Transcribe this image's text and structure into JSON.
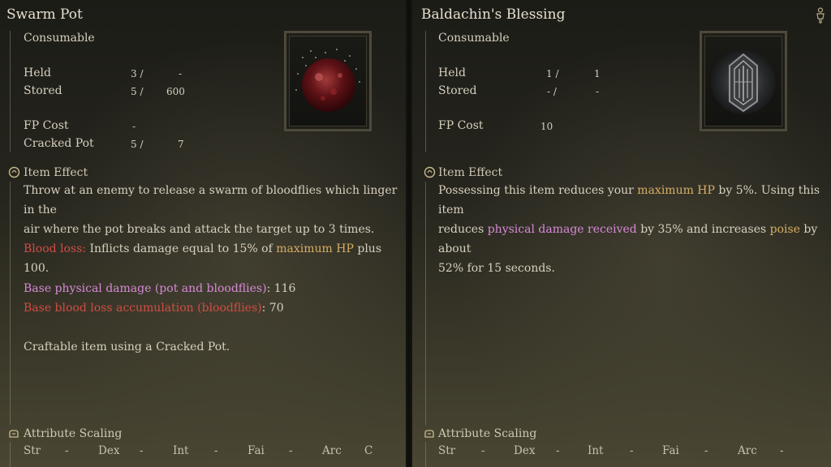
{
  "left": {
    "title": "Swarm Pot",
    "type": "Consumable",
    "stats": {
      "held_label": "Held",
      "held_cur": "3 /",
      "held_max": "-",
      "stored_label": "Stored",
      "stored_cur": "5 /",
      "stored_max": "600",
      "fp_label": "FP Cost",
      "fp_val": "-",
      "cracked_label": "Cracked Pot",
      "cracked_cur": "5 /",
      "cracked_max": "7"
    },
    "effect_title": "Item Effect",
    "effect_line1": "Throw at an enemy to release a swarm of bloodflies which linger in the",
    "effect_line2": "air where the pot breaks and attack the target up to 3 times.",
    "blood_label": "Blood loss:",
    "blood_text_a": " Inflicts damage equal to 15% of ",
    "blood_hl": "maximum HP",
    "blood_text_b": " plus 100.",
    "base_phys_label": "Base physical damage (pot and bloodflies)",
    "base_phys_val": ": 116",
    "base_blood_label": "Base blood loss accumulation (bloodflies)",
    "base_blood_val": ": 70",
    "craft_text": "Craftable item using a Cracked Pot.",
    "scaling_title": "Attribute Scaling",
    "scaling": [
      {
        "attr": "Str",
        "val": "-"
      },
      {
        "attr": "Dex",
        "val": "-"
      },
      {
        "attr": "Int",
        "val": "-"
      },
      {
        "attr": "Fai",
        "val": "-"
      },
      {
        "attr": "Arc",
        "val": "C"
      }
    ]
  },
  "right": {
    "title": "Baldachin's Blessing",
    "type": "Consumable",
    "stats": {
      "held_label": "Held",
      "held_cur": "1 /",
      "held_max": "1",
      "stored_label": "Stored",
      "stored_cur": "- /",
      "stored_max": "-",
      "fp_label": "FP Cost",
      "fp_val": "10"
    },
    "effect_title": "Item Effect",
    "l1_a": "Possessing this item reduces your ",
    "l1_hl": "maximum HP",
    "l1_b": " by 5%. Using this item",
    "l2_a": "reduces ",
    "l2_hl": "physical damage received",
    "l2_b": " by 35% and increases ",
    "l2_hl2": "poise",
    "l2_c": " by about",
    "l3": "52% for 15 seconds.",
    "scaling_title": "Attribute Scaling",
    "scaling": [
      {
        "attr": "Str",
        "val": "-"
      },
      {
        "attr": "Dex",
        "val": "-"
      },
      {
        "attr": "Int",
        "val": "-"
      },
      {
        "attr": "Fai",
        "val": "-"
      },
      {
        "attr": "Arc",
        "val": "-"
      }
    ]
  },
  "colors": {
    "highlight_gold": "#d6ad63",
    "blood_red": "#d44c44",
    "physical_pink": "#d78ad6"
  },
  "icons": {
    "effect": "item-effect-icon",
    "scaling": "attribute-scaling-icon",
    "character": "character-icon"
  }
}
